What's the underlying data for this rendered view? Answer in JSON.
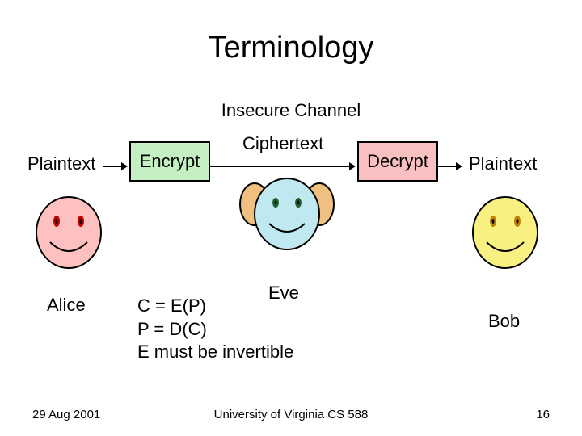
{
  "title": "Terminology",
  "subtitle": "Insecure Channel",
  "labels": {
    "plaintext_left": "Plaintext",
    "encrypt": "Encrypt",
    "ciphertext": "Ciphertext",
    "decrypt": "Decrypt",
    "plaintext_right": "Plaintext"
  },
  "people": {
    "alice": "Alice",
    "eve": "Eve",
    "bob": "Bob"
  },
  "equations": {
    "line1": "C = E(P)",
    "line2": "P = D(C)",
    "line3": "E must be invertible"
  },
  "footer": {
    "date": "29 Aug 2001",
    "center": "University of Virginia CS 588",
    "page": "16"
  }
}
